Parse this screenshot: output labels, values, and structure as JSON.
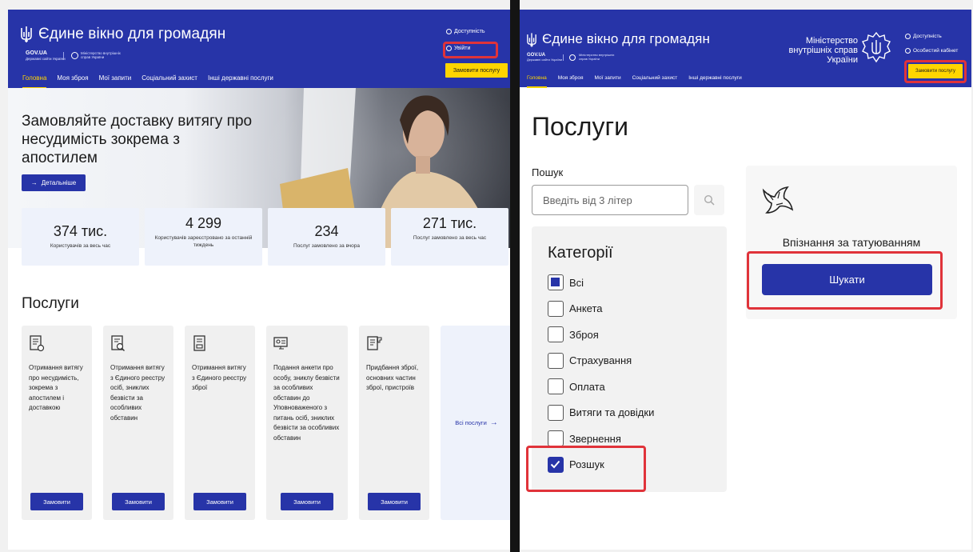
{
  "left": {
    "header": {
      "site_title": "Єдине вікно для громадян",
      "gov_label": "GOV.UA",
      "gov_sub": "Державні сайти України",
      "mvs_line1": "Міністерство внутрішніх",
      "mvs_line2": "справ України",
      "accessibility": "Доступність",
      "login": "Увійти",
      "order_service": "Замовити послугу"
    },
    "nav": [
      "Головна",
      "Моя зброя",
      "Мої запити",
      "Соціальний захист",
      "Інші державні послуги"
    ],
    "hero": {
      "title": "Замовляйте доставку витягу про несудимість зокрема з апостилем",
      "details_button": "Детальніше"
    },
    "stats": [
      {
        "value": "374 тис.",
        "label": "Користувачів за весь час"
      },
      {
        "value": "4 299",
        "label": "Користувачів зареєстровано за останній тиждень"
      },
      {
        "value": "234",
        "label": "Послуг замовлено за вчора"
      },
      {
        "value": "271 тис.",
        "label": "Послуг замовлено за весь час"
      }
    ],
    "services_heading": "Послуги",
    "cards": [
      {
        "title": "Отримання витягу про несудимість, зокрема з апостилем і доставкою",
        "button": "Замовити",
        "icon": "certificate-icon"
      },
      {
        "title": "Отримання витягу з Єдиного реєстру осіб, зниклих безвісти за особливих обставин",
        "button": "Замовити",
        "icon": "document-search-icon"
      },
      {
        "title": "Отримання витягу з Єдиного реєстру зброї",
        "button": "Замовити",
        "icon": "document-stamp-icon"
      },
      {
        "title": "Подання анкети про особу, зниклу безвісти за особливих обставин до Уповноваженого з питань осіб, зниклих безвісти за особливих обставин",
        "button": "Замовити",
        "icon": "monitor-form-icon"
      },
      {
        "title": "Придбання зброї, основних частин зброї, пристроїв",
        "button": "Замовити",
        "icon": "gun-document-icon"
      }
    ],
    "all_services": "Всі послуги"
  },
  "right": {
    "header": {
      "site_title": "Єдине вікно для громадян",
      "gov_label": "GOV.UA",
      "gov_sub": "Державні сайти України",
      "mvs_line1": "Міністерство внутрішніх",
      "mvs_line2": "справ України",
      "ministry_line1": "Міністерство",
      "ministry_line2": "внутрішніх справ",
      "ministry_line3": "України",
      "accessibility": "Доступність",
      "cabinet": "Особистий кабінет",
      "order_service": "Замовити послугу"
    },
    "nav": [
      "Головна",
      "Моя зброя",
      "Мої запити",
      "Соціальний захист",
      "Інші державні послуги"
    ],
    "page_title": "Послуги",
    "search": {
      "label": "Пошук",
      "placeholder": "Введіть від 3 літер"
    },
    "categories": {
      "heading": "Категорії",
      "items": [
        {
          "label": "Всі",
          "state": "partial"
        },
        {
          "label": "Анкета",
          "state": "unchecked"
        },
        {
          "label": "Зброя",
          "state": "unchecked"
        },
        {
          "label": "Страхування",
          "state": "unchecked"
        },
        {
          "label": "Оплата",
          "state": "unchecked"
        },
        {
          "label": "Витяги та довідки",
          "state": "unchecked"
        },
        {
          "label": "Звернення",
          "state": "unchecked"
        },
        {
          "label": "Розшук",
          "state": "checked"
        }
      ]
    },
    "tattoo_card": {
      "title": "Впізнання за татуюванням",
      "button": "Шукати",
      "icon": "swallow-tattoo-icon"
    }
  },
  "colors": {
    "brand_blue": "#2734a8",
    "accent_yellow": "#ffd500",
    "highlight_red": "#e0333a"
  }
}
